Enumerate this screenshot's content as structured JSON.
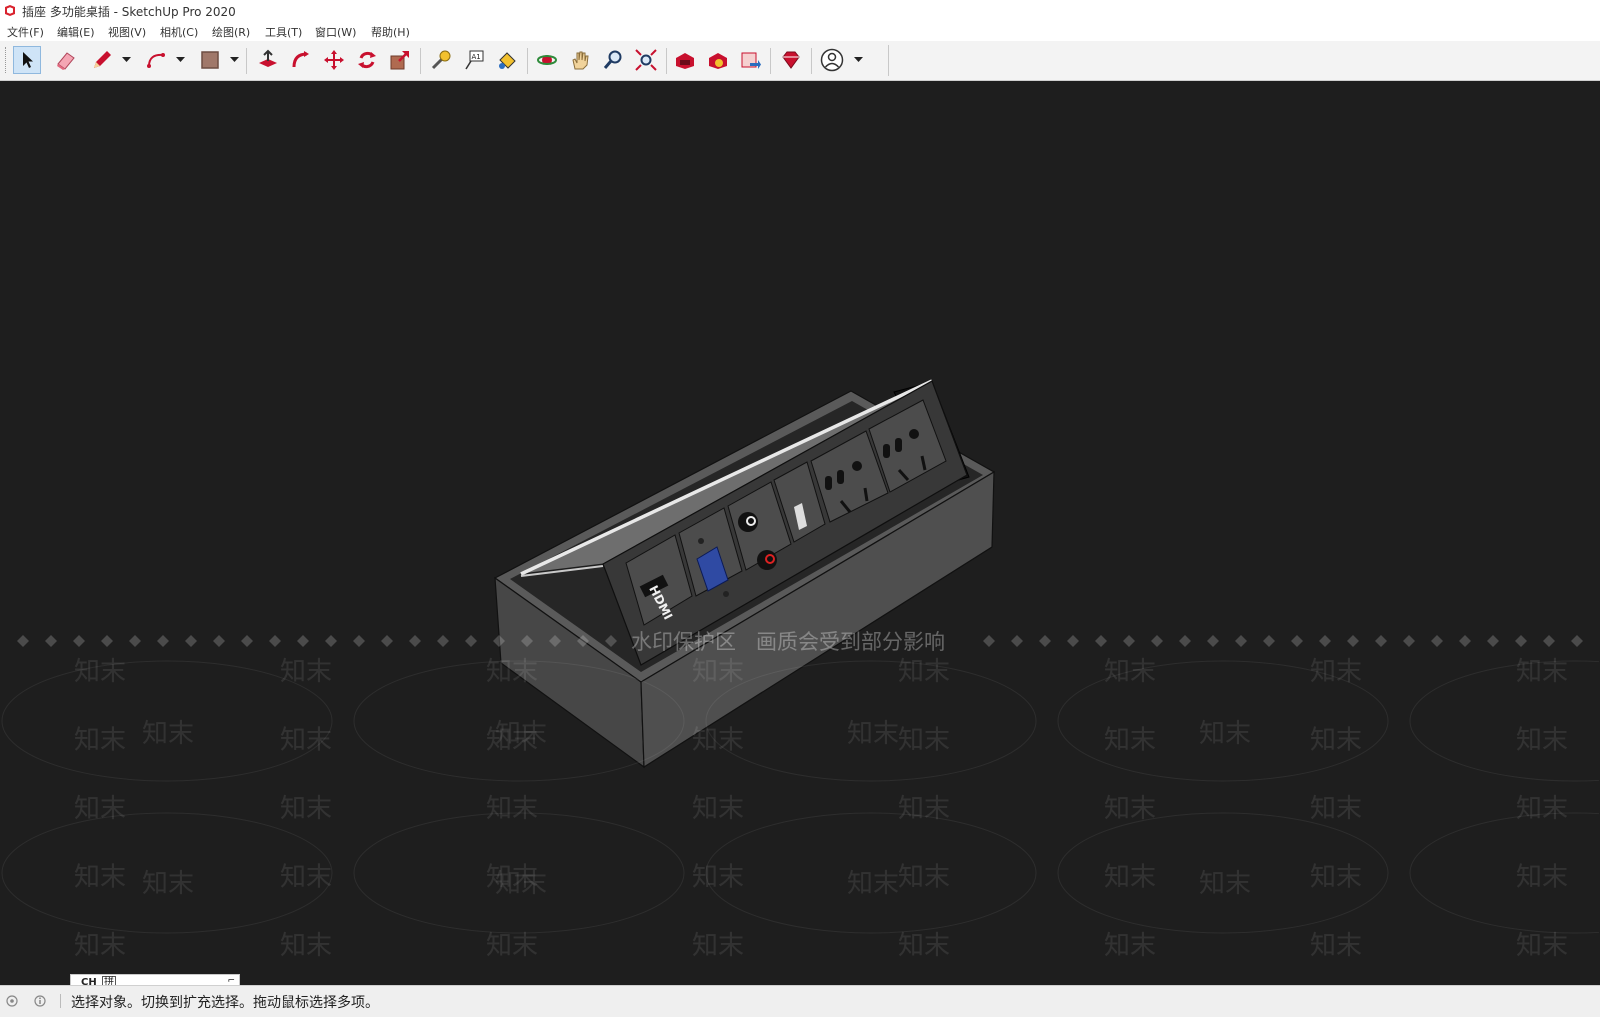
{
  "window": {
    "title": "插座 多功能桌插 - SketchUp Pro 2020"
  },
  "menu": [
    "文件(F)",
    "编辑(E)",
    "视图(V)",
    "相机(C)",
    "绘图(R)",
    "工具(T)",
    "窗口(W)",
    "帮助(H)"
  ],
  "toolbar": {
    "tools": [
      "select-tool",
      "eraser-tool",
      "pencil-tool",
      "arc-tool",
      "rectangle-tool",
      "push-pull-tool",
      "follow-me-tool",
      "move-tool",
      "rotate-tool",
      "scale-tool",
      "tape-measure-tool",
      "text-tool",
      "paint-bucket-tool",
      "orbit-tool",
      "pan-tool",
      "zoom-tool",
      "zoom-extents-tool",
      "3d-warehouse-tool",
      "extension-warehouse-tool",
      "send-to-layout-tool",
      "extension-manager-tool",
      "account-tool"
    ],
    "text_tool_label": "A1",
    "product_labels": {
      "hdmi": "HDMI"
    }
  },
  "viewport": {
    "background": "#1e1e1e",
    "watermark": {
      "banner": "水印保护区   画质会受到部分影响",
      "mark": "知末"
    }
  },
  "ime": {
    "lang": "CH",
    "mode": "拼"
  },
  "status": {
    "text": "选择对象。切换到扩充选择。拖动鼠标选择多项。"
  },
  "colors": {
    "toolbar_bg": "#f3f3f3",
    "active_tool_bg": "#cfe4f7",
    "accent_red": "#c8102e"
  }
}
